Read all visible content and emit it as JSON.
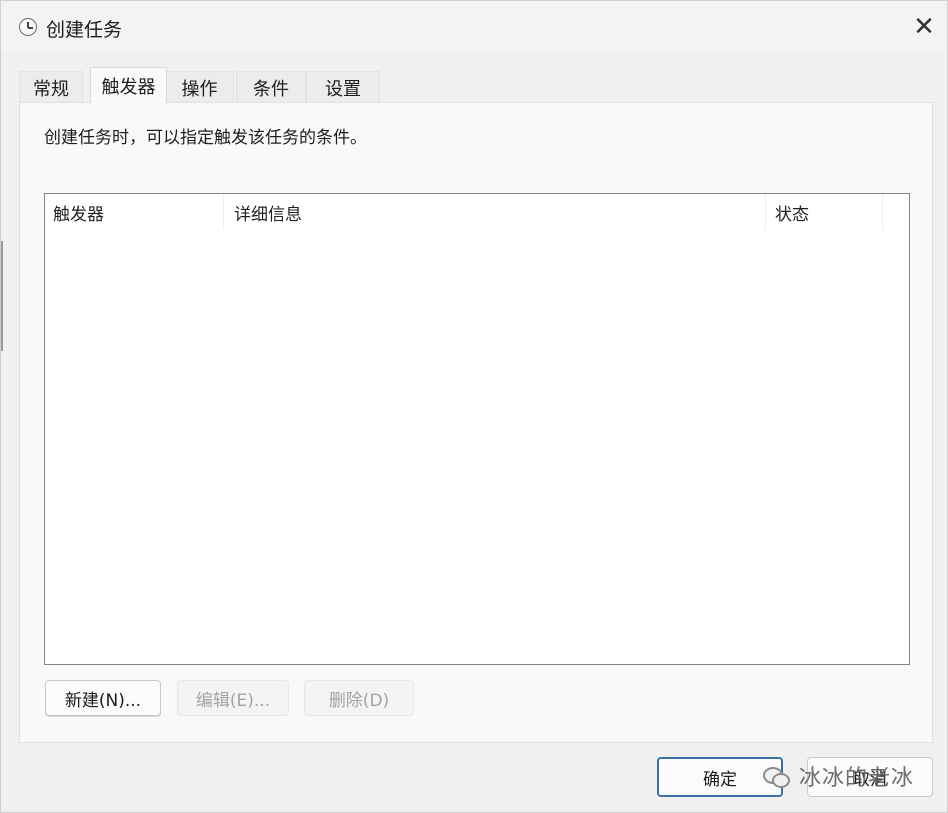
{
  "window": {
    "title": "创建任务",
    "close_glyph": "✕"
  },
  "tabs": [
    {
      "label": "常规",
      "active": false
    },
    {
      "label": "触发器",
      "active": true
    },
    {
      "label": "操作",
      "active": false
    },
    {
      "label": "条件",
      "active": false
    },
    {
      "label": "设置",
      "active": false
    }
  ],
  "triggers_tab": {
    "description": "创建任务时，可以指定触发该任务的条件。",
    "columns": [
      "触发器",
      "详细信息",
      "状态"
    ],
    "rows": []
  },
  "buttons": {
    "new": {
      "label": "新建(N)...",
      "enabled": true
    },
    "edit": {
      "label": "编辑(E)...",
      "enabled": false
    },
    "delete": {
      "label": "删除(D)",
      "enabled": false
    }
  },
  "footer": {
    "ok_label": "确定",
    "cancel_label": "取消"
  },
  "watermark": {
    "text": "冰冰的老冰",
    "icon": "wechat-icon"
  },
  "icons": {
    "app": "clock-icon",
    "close": "close-icon"
  },
  "colors": {
    "window_bg": "#f0f0f0",
    "panel_bg": "#f9f9f9",
    "list_border": "#858585",
    "primary_border": "#3c6fa8",
    "disabled_text": "#a3a3a3"
  }
}
